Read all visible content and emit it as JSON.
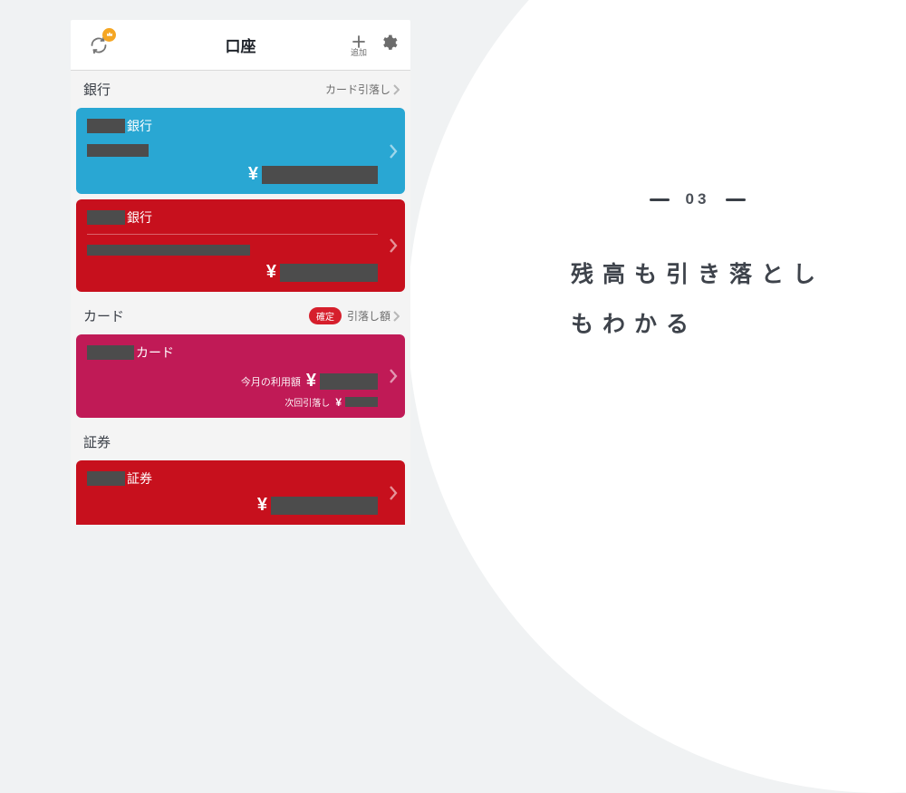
{
  "header": {
    "title": "口座",
    "add_label": "追加"
  },
  "sections": {
    "bank": {
      "title": "銀行",
      "link_label": "カード引落し"
    },
    "card": {
      "title": "カード",
      "badge": "確定",
      "link_label": "引落し額"
    },
    "securities": {
      "title": "証券"
    }
  },
  "accounts": {
    "bank1": {
      "suffix": "銀行",
      "currency": "¥"
    },
    "bank2": {
      "suffix": "銀行",
      "currency": "¥"
    },
    "card1": {
      "suffix": "カード",
      "usage_label": "今月の利用額",
      "next_debit_label": "次回引落し",
      "currency": "¥"
    },
    "sec1": {
      "suffix": "証券",
      "currency": "¥"
    }
  },
  "hero": {
    "number": "03",
    "headline_line1": "残高も引き落とし",
    "headline_line2": "もわかる"
  }
}
